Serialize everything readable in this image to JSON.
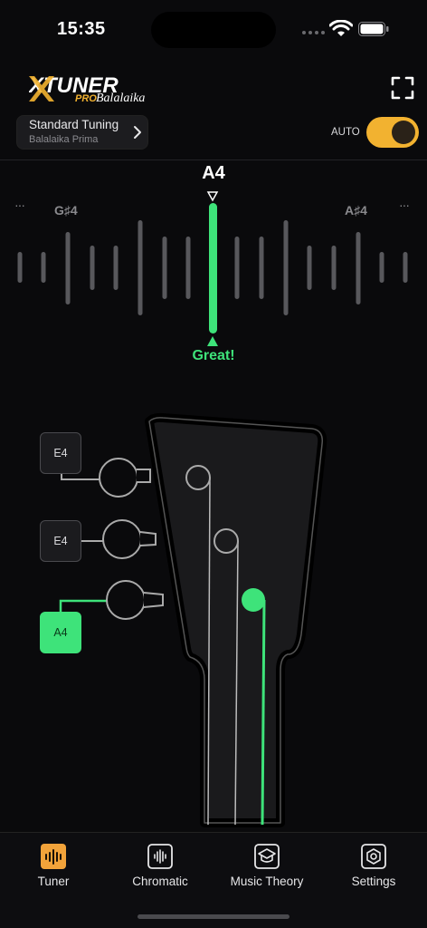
{
  "status_bar": {
    "time": "15:35"
  },
  "header": {
    "logo_text": "XTUNER",
    "logo_pro": "PRO",
    "logo_sub": "Balalaika",
    "tuning_title": "Standard Tuning",
    "tuning_subtitle": "Balalaika Prima",
    "auto_label": "AUTO",
    "auto_enabled": true
  },
  "meter": {
    "current_note": "A4",
    "left_note": "G♯4",
    "right_note": "A♯4",
    "dots": "···",
    "status": "Great!",
    "accent_color": "#3ee37a"
  },
  "strings": [
    {
      "label": "E4",
      "active": false
    },
    {
      "label": "E4",
      "active": false
    },
    {
      "label": "A4",
      "active": true
    }
  ],
  "nav": {
    "items": [
      {
        "label": "Tuner",
        "icon": "tuner-icon",
        "active": true
      },
      {
        "label": "Chromatic",
        "icon": "chromatic-icon",
        "active": false
      },
      {
        "label": "Music Theory",
        "icon": "music-theory-icon",
        "active": false
      },
      {
        "label": "Settings",
        "icon": "settings-icon",
        "active": false
      }
    ]
  },
  "colors": {
    "accent": "#f2b230",
    "success": "#3ee37a",
    "background": "#0a0a0c"
  }
}
